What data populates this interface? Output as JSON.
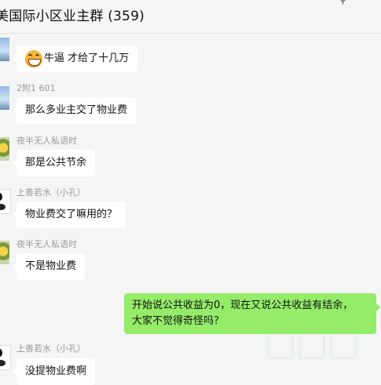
{
  "header": {
    "title": "美国际小区业主群 (359)",
    "pin_icon": "pin-icon"
  },
  "messages": [
    {
      "sender": "",
      "avatar": "sky-avatar",
      "emoji": "grinning-face-emoji",
      "text": "牛逼  才给了十几万"
    },
    {
      "sender": "2附1   601",
      "avatar": "sky-avatar",
      "text": "那么多业主交了物业费"
    },
    {
      "sender": "夜半无人私语时",
      "avatar": "flower-avatar",
      "text": "那是公共节余"
    },
    {
      "sender": "上善若水（小孔）",
      "avatar": "panda-avatar",
      "text": "物业费交了嘛用的？"
    },
    {
      "sender": "夜半无人私语时",
      "avatar": "flower-avatar",
      "text": "不是物业费"
    },
    {
      "sender": "上善若水（小孔）",
      "avatar": "panda-avatar",
      "text": "没提物业费啊"
    }
  ],
  "my_message": {
    "line1": "开始说公共收益为0，现在又说公共收益有结余，",
    "line2": "大家不觉得奇怪吗？"
  },
  "colors": {
    "background": "#f5f5f5",
    "incoming_bubble": "#ffffff",
    "outgoing_bubble": "#95ec69",
    "sender_name": "#9a9a9a"
  }
}
